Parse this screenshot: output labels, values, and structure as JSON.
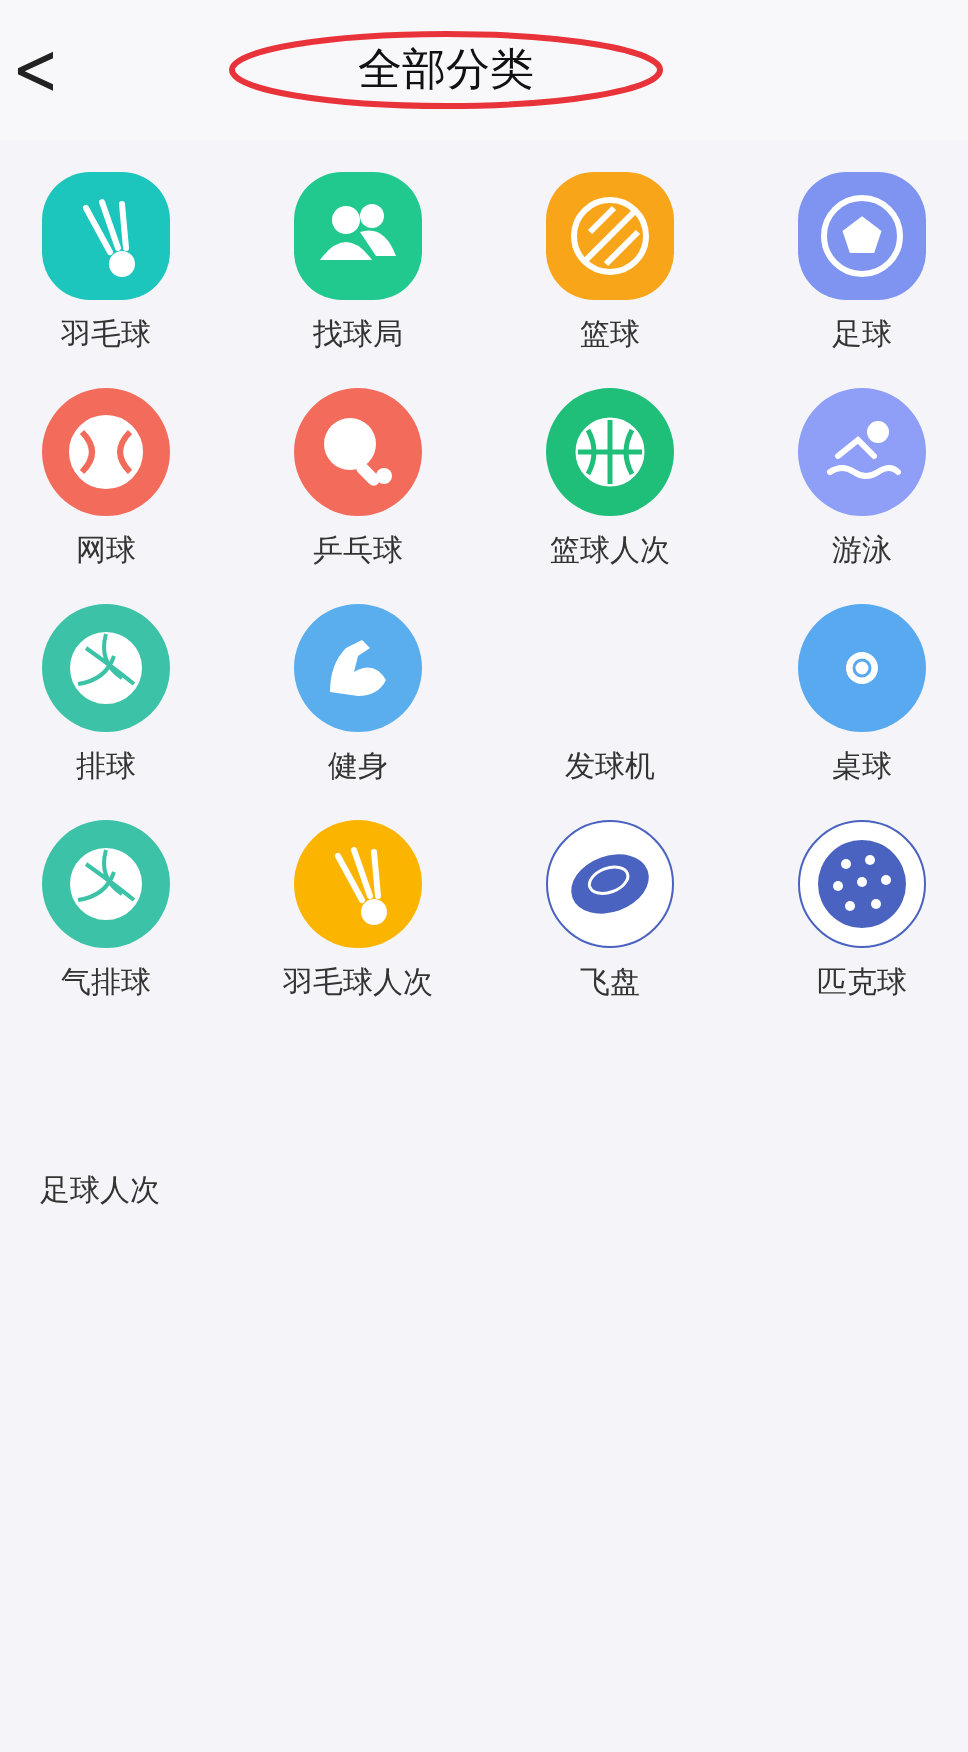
{
  "header": {
    "back": "<",
    "title": "全部分类",
    "title_circled": true
  },
  "categories": [
    {
      "label": "羽毛球",
      "kind": "shuttlecock",
      "color": "#1cc6bd"
    },
    {
      "label": "找球局",
      "kind": "people",
      "color": "#22c98e"
    },
    {
      "label": "篮球",
      "kind": "striped",
      "color": "#f9a51a"
    },
    {
      "label": "足球",
      "kind": "soccer",
      "color": "#7f93f0"
    },
    {
      "label": "网球",
      "kind": "tennis",
      "color": "#f26b5b"
    },
    {
      "label": "乒乓球",
      "kind": "paddle",
      "color": "#f26b5b"
    },
    {
      "label": "篮球人次",
      "kind": "basketball",
      "color": "#1fbf7a"
    },
    {
      "label": "游泳",
      "kind": "swimmer",
      "color": "#8f9ef6"
    },
    {
      "label": "排球",
      "kind": "volleyball",
      "color": "#3cc2a6"
    },
    {
      "label": "健身",
      "kind": "arm",
      "color": "#5aaeed"
    },
    {
      "label": "发球机",
      "kind": "blank"
    },
    {
      "label": "桌球",
      "kind": "eightball",
      "color": "#58a9ef"
    },
    {
      "label": "气排球",
      "kind": "volleyball",
      "color": "#3cc2a6"
    },
    {
      "label": "羽毛球人次",
      "kind": "shuttlecock",
      "color": "#fbb400"
    },
    {
      "label": "飞盘",
      "kind": "frisbee",
      "color": "#4a63c0"
    },
    {
      "label": "匹克球",
      "kind": "pickleball",
      "color": "#4a63c0"
    }
  ],
  "extra": {
    "label": "足球人次"
  }
}
